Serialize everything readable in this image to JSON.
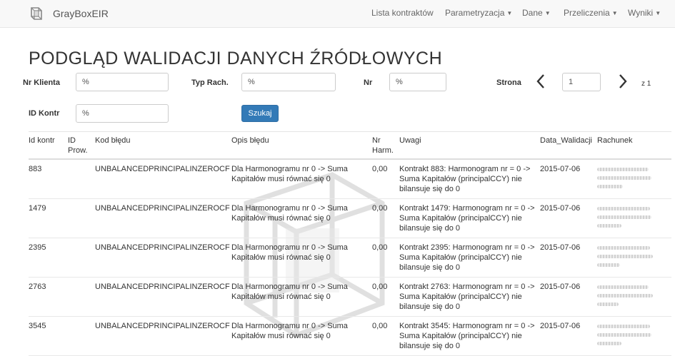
{
  "nav": {
    "brand": "GrayBoxEIR",
    "items": [
      {
        "label": "Lista kontraktów",
        "caret": false
      },
      {
        "label": "Parametryzacja",
        "caret": true
      },
      {
        "label": "Dane",
        "caret": true
      },
      {
        "label": "Przeliczenia",
        "caret": true
      },
      {
        "label": "Wyniki",
        "caret": true
      }
    ]
  },
  "page": {
    "title": "PODGLĄD WALIDACJI DANYCH ŹRÓDŁOWYCH"
  },
  "filters": {
    "nr_klienta": {
      "label": "Nr Klienta",
      "value": "%"
    },
    "typ_rach": {
      "label": "Typ Rach.",
      "value": "%"
    },
    "nr": {
      "label": "Nr",
      "value": "%"
    },
    "id_kontr": {
      "label": "ID Kontr",
      "value": "%"
    },
    "search_label": "Szukaj"
  },
  "pager": {
    "label": "Strona",
    "page": "1",
    "of": "z 1"
  },
  "table": {
    "headers": {
      "id_kontr": "Id kontr",
      "id_prow_1": "ID",
      "id_prow_2": "Prow.",
      "kod": "Kod błędu",
      "opis": "Opis błędu",
      "nrh_1": "Nr",
      "nrh_2": "Harm.",
      "uwagi": "Uwagi",
      "data": "Data_Walidacji",
      "rachunek": "Rachunek"
    },
    "rows": [
      {
        "id": "883",
        "prow": "",
        "kod": "UNBALANCEDPRINCIPALINZEROCF",
        "opis1": "Dla Harmonogramu nr 0 -> Suma",
        "opis2": "Kapitałów musi równać się 0",
        "nrh": "0,00",
        "uwagi1": "Kontrakt 883: Harmonogram nr = 0 ->",
        "uwagi2": "Suma Kapitałów (principalCCY) nie",
        "uwagi3": "bilansuje się do 0",
        "data": "2015-07-06"
      },
      {
        "id": "1479",
        "prow": "",
        "kod": "UNBALANCEDPRINCIPALINZEROCF",
        "opis1": "Dla Harmonogramu nr 0 -> Suma",
        "opis2": "Kapitałów musi równać się 0",
        "nrh": "0,00",
        "uwagi1": "Kontrakt 1479: Harmonogram nr = 0 ->",
        "uwagi2": "Suma Kapitałów (principalCCY) nie",
        "uwagi3": "bilansuje się do 0",
        "data": "2015-07-06"
      },
      {
        "id": "2395",
        "prow": "",
        "kod": "UNBALANCEDPRINCIPALINZEROCF",
        "opis1": "Dla Harmonogramu nr 0 -> Suma",
        "opis2": "Kapitałów musi równać się 0",
        "nrh": "0,00",
        "uwagi1": "Kontrakt 2395: Harmonogram nr = 0 ->",
        "uwagi2": "Suma Kapitałów (principalCCY) nie",
        "uwagi3": "bilansuje się do 0",
        "data": "2015-07-06"
      },
      {
        "id": "2763",
        "prow": "",
        "kod": "UNBALANCEDPRINCIPALINZEROCF",
        "opis1": "Dla Harmonogramu nr 0 -> Suma",
        "opis2": "Kapitałów musi równać się 0",
        "nrh": "0,00",
        "uwagi1": "Kontrakt 2763: Harmonogram nr = 0 ->",
        "uwagi2": "Suma Kapitałów (principalCCY) nie",
        "uwagi3": "bilansuje się do 0",
        "data": "2015-07-06"
      },
      {
        "id": "3545",
        "prow": "",
        "kod": "UNBALANCEDPRINCIPALINZEROCF",
        "opis1": "Dla Harmonogramu nr 0 -> Suma",
        "opis2": "Kapitałów musi równać się 0",
        "nrh": "0,00",
        "uwagi1": "Kontrakt 3545: Harmonogram nr = 0 ->",
        "uwagi2": "Suma Kapitałów (principalCCY) nie",
        "uwagi3": "bilansuje się do 0",
        "data": "2015-07-06"
      }
    ]
  },
  "colors": {
    "primary": "#337ab7",
    "navbar_bg": "#f8f8f8",
    "text": "#333333"
  }
}
